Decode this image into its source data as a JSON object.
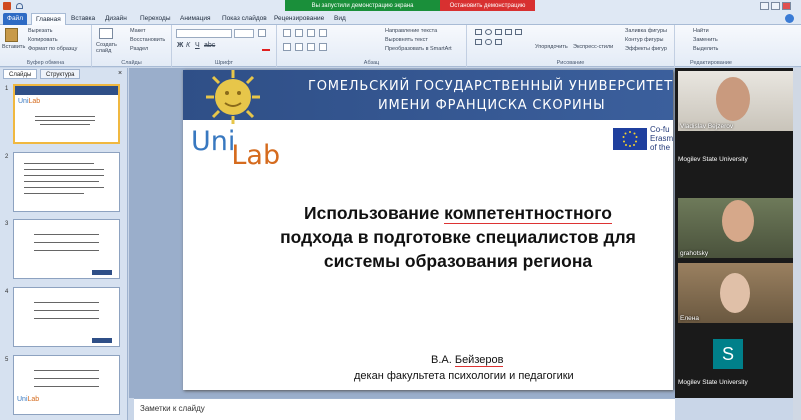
{
  "titlebar": {
    "sharing_status": "Вы запустили демонстрацию экрана",
    "stop_sharing": "Остановить демонстрацию"
  },
  "tabs": [
    "Файл",
    "Главная",
    "Вставка",
    "Дизайн",
    "Переходы",
    "Анимация",
    "Показ слайдов",
    "Рецензирование",
    "Вид"
  ],
  "ribbon": {
    "clipboard": {
      "paste": "Вставить",
      "cut": "Вырезать",
      "copy": "Копировать",
      "format": "Формат по образцу",
      "label": "Буфер обмена"
    },
    "slides": {
      "new": "Создать слайд",
      "layout": "Макет",
      "reset": "Восстановить",
      "section": "Раздел",
      "label": "Слайды"
    },
    "font": {
      "label": "Шрифт"
    },
    "paragraph": {
      "text_direction": "Направление текста",
      "align_text": "Выровнять текст",
      "smartart": "Преобразовать в SmartArt",
      "label": "Абзац"
    },
    "drawing": {
      "arrange": "Упорядочить",
      "quick_styles": "Экспресс-стили",
      "fill": "Заливка фигуры",
      "outline": "Контур фигуры",
      "effects": "Эффекты фигур",
      "label": "Рисование"
    },
    "editing": {
      "find": "Найти",
      "replace": "Заменить",
      "select": "Выделить",
      "label": "Редактирование"
    }
  },
  "leftpanel": {
    "tab_slides": "Слайды",
    "tab_outline": "Структура",
    "thumb_numbers": [
      "1",
      "2",
      "3",
      "4",
      "5"
    ]
  },
  "slide": {
    "university_line1": "ГОМЕЛЬСКИЙ ГОСУДАРСТВЕННЫЙ УНИВЕРСИТЕТ",
    "university_line2": "ИМЕНИ ФРАНЦИСКА СКОРИНЫ",
    "logo_uni": "Uni",
    "logo_lab": "Lab",
    "cofund_line1": "Co-fu",
    "cofund_line2": "Erasm",
    "cofund_line3": "of the",
    "title_line1_a": "Использование ",
    "title_line1_b": "компетентностного",
    "title_line2": "подхода в подготовке специалистов для",
    "title_line3": "системы образования региона",
    "author_initials": "В.А. ",
    "author_surname": "Бейзеров",
    "author_position": "декан факультета психологии и педагогики"
  },
  "notes_placeholder": "Заметки к слайду",
  "participants": [
    {
      "name": "Vladislav Bejzerov",
      "org": "Mogilev State University"
    },
    {
      "name": "grahotsky",
      "org": ""
    },
    {
      "name": "Елена",
      "org": ""
    },
    {
      "name": "",
      "org": "Mogilev State University",
      "initial": "S"
    }
  ],
  "colors": {
    "accent": "#2e6bc4",
    "header": "#2f4f87",
    "share_green": "#1a8f3a",
    "share_red": "#d83030"
  }
}
